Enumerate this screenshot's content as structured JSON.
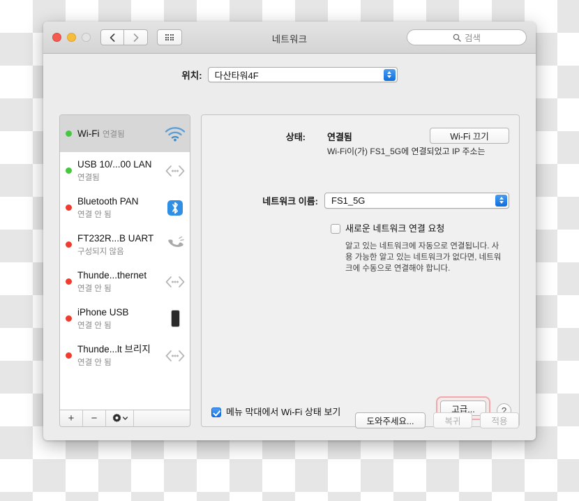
{
  "window": {
    "title": "네트워크",
    "traffic_lights": [
      "close",
      "minimize",
      "zoom"
    ],
    "search": {
      "placeholder": "검색",
      "icon": "search-icon"
    },
    "nav": {
      "back": "back-chevron-icon",
      "forward": "forward-chevron-icon",
      "grid": "all-preferences-grid-icon"
    }
  },
  "location": {
    "label": "위치:",
    "value": "다산타워4F"
  },
  "sidebar": {
    "services": [
      {
        "name": "Wi-Fi",
        "status": "연결됨",
        "dot": "green",
        "icon": "wifi-icon",
        "selected": true
      },
      {
        "name": "USB 10/...00 LAN",
        "status": "연결됨",
        "dot": "green",
        "icon": "ethernet-icon",
        "selected": false
      },
      {
        "name": "Bluetooth PAN",
        "status": "연결 안 됨",
        "dot": "red",
        "icon": "bluetooth-icon",
        "selected": false
      },
      {
        "name": "FT232R...B UART",
        "status": "구성되지 않음",
        "dot": "red",
        "icon": "modem-icon",
        "selected": false
      },
      {
        "name": "Thunde...thernet",
        "status": "연결 안 됨",
        "dot": "red",
        "icon": "ethernet-icon",
        "selected": false
      },
      {
        "name": "iPhone USB",
        "status": "연결 안 됨",
        "dot": "red",
        "icon": "iphone-icon",
        "selected": false
      },
      {
        "name": "Thunde...lt 브리지",
        "status": "연결 안 됨",
        "dot": "red",
        "icon": "ethernet-icon",
        "selected": false
      }
    ],
    "toolbar": {
      "add": "+",
      "remove": "−",
      "actions": "gear-icon"
    }
  },
  "main": {
    "status_label": "상태:",
    "status_value": "연결됨",
    "status_description": "Wi-Fi이(가) FS1_5G에 연결되었고 IP 주소는",
    "wifi_toggle_label": "Wi-Fi 끄기",
    "network_name_label": "네트워크 이름:",
    "network_name_value": "FS1_5G",
    "ask_new_network": {
      "label": "새로운 네트워크 연결 요청",
      "checked": false,
      "description": "알고 있는 네트워크에 자동으로 연결됩니다. 사용 가능한 알고 있는 네트워크가 없다면, 네트워크에 수동으로 연결해야 합니다."
    },
    "menubar_status": {
      "label": "메뉴 막대에서 Wi-Fi 상태 보기",
      "checked": true
    },
    "advanced_label": "고급...",
    "help_label": "?"
  },
  "footer": {
    "help": "도와주세요...",
    "revert": "복귀",
    "apply": "적용"
  },
  "colors": {
    "accent_blue": "#1470e6",
    "connected_green": "#45c83d",
    "disconnected_red": "#f03c2e",
    "highlight_ring": "#f0a8ab"
  }
}
